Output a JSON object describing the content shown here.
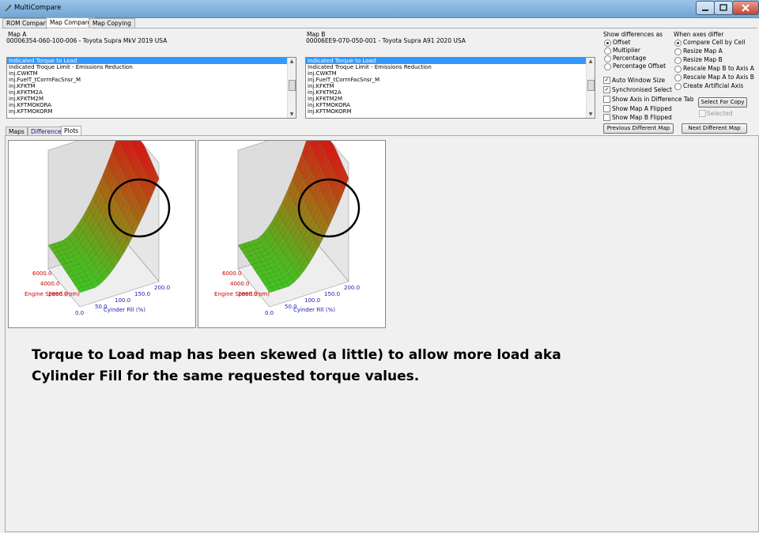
{
  "window": {
    "title": "MultiCompare"
  },
  "top_tabs": [
    {
      "label": "ROM Compare"
    },
    {
      "label": "Map Compare"
    },
    {
      "label": "Map Copying"
    }
  ],
  "map_a": {
    "label": "Map A",
    "rom": "00006354-060-100-006 - Toyota Supra MkV 2019 USA",
    "items": [
      "Indicated Torque to Load",
      "Indicated Troque Limit - Emissions Reduction",
      "inj.CWKTM",
      "inj.FuelT_tCorrnFacSnsr_M",
      "inj.KFKTM",
      "inj.KFKTM2A",
      "inj.KFKTM2M",
      "inj.KFTMOKORA",
      "inj.KFTMOKORM"
    ],
    "selected_index": 0
  },
  "map_b": {
    "label": "Map B",
    "rom": "00006EE9-070-050-001 - Toyota Supra A91 2020 USA",
    "items": [
      "Indicated Torque to Load",
      "Indicated Troque Limit - Emissions Reduction",
      "inj.CWKTM",
      "inj.FuelT_tCorrnFacSnsr_M",
      "inj.KFKTM",
      "inj.KFKTM2A",
      "inj.KFKTM2M",
      "inj.KFTMOKORA",
      "inj.KFTMOKORM"
    ],
    "selected_index": 0
  },
  "show_differences": {
    "label": "Show differences as",
    "options": [
      "Offset",
      "Multiplier",
      "Percentage",
      "Percentage Offset"
    ],
    "selected": "Offset"
  },
  "axes_differ": {
    "label": "When axes differ",
    "options": [
      "Compare Cell by Cell",
      "Resize Map A",
      "Resize Map B",
      "Rescale Map B to Axis A",
      "Rescale Map A to Axis B",
      "Create Artificial Axis"
    ],
    "selected": "Compare Cell by Cell"
  },
  "checkboxes": [
    {
      "label": "Auto Window Size",
      "checked": true
    },
    {
      "label": "Synchronised Select",
      "checked": true
    },
    {
      "label": "Show Axis in Difference Tab",
      "checked": false
    },
    {
      "label": "Show Map A Flipped",
      "checked": false
    },
    {
      "label": "Show Map B Flipped",
      "checked": false
    }
  ],
  "buttons": {
    "select_for_copy": "Select For Copy",
    "selected_label": "Selected",
    "prev_diff": "Previous Different Map",
    "next_diff": "Next Different Map"
  },
  "inner_tabs": [
    {
      "label": "Maps"
    },
    {
      "label": "Difference"
    },
    {
      "label": "Plots"
    }
  ],
  "plot": {
    "y_axis_label": "Engine Speed (rpm)",
    "y_ticks": [
      "6000.0",
      "4000.0",
      "2000.0"
    ],
    "x_axis_label": "Cyinder Fill (%)",
    "x_ticks": [
      "0.0",
      "50.0",
      "100.0",
      "150.0",
      "200.0"
    ],
    "colors": {
      "low": "#22dd22",
      "high": "#dd1111",
      "y_axis": "#cc0000",
      "x_axis": "#1a1aaa"
    }
  },
  "annotation": {
    "line1": "Torque to Load map has been skewed (a little) to allow more load aka",
    "line2": "Cylinder Fill for the same requested torque values."
  }
}
